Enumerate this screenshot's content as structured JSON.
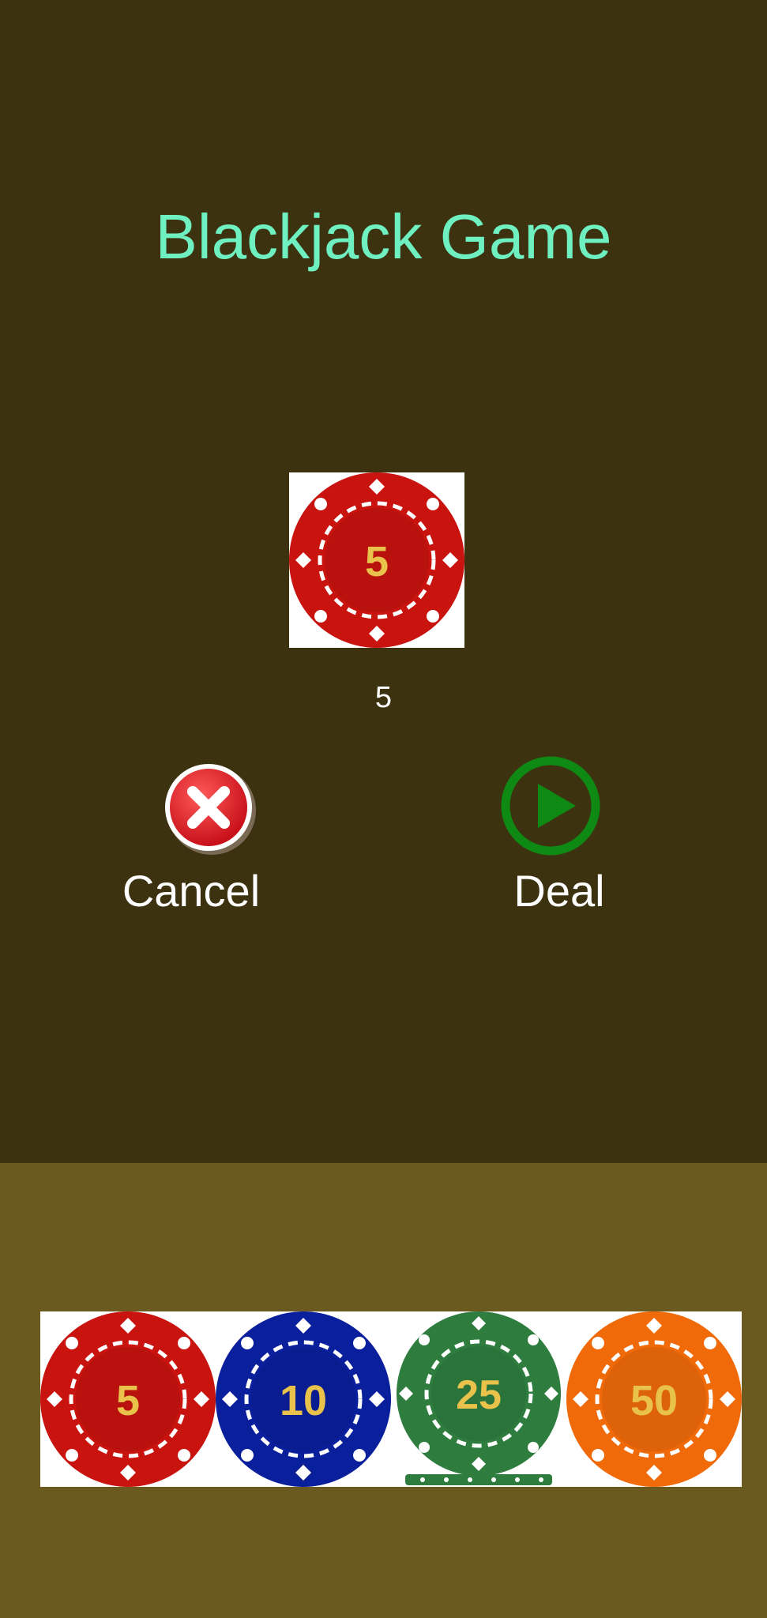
{
  "colors": {
    "top_background": "#3d3210",
    "bottom_background": "#6b5a1f",
    "title_color": "#6ef0c0",
    "chip_text": "#e8c24a"
  },
  "title": "Blackjack Game",
  "bet": {
    "chip_value": "5",
    "chip_color": "#c8130f",
    "amount": "5"
  },
  "actions": {
    "cancel_label": "Cancel",
    "cancel_icon": "close-circle-icon",
    "deal_label": "Deal",
    "deal_icon": "play-circle-icon"
  },
  "chips": [
    {
      "value": "5",
      "color": "#c8130f"
    },
    {
      "value": "10",
      "color": "#0a1f9c"
    },
    {
      "value": "25",
      "color": "#2e7d3f"
    },
    {
      "value": "50",
      "color": "#f06a0a"
    }
  ]
}
